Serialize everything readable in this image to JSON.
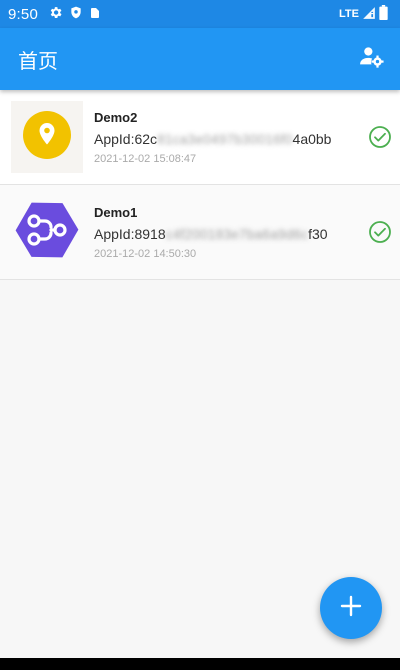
{
  "status_bar": {
    "time": "9:50",
    "network": "LTE",
    "icons": [
      "gear-icon",
      "shield-icon",
      "sim-card-icon",
      "signal-icon",
      "battery-icon"
    ]
  },
  "app_bar": {
    "title": "首页",
    "settings_icon": "user-settings-icon"
  },
  "apps": [
    {
      "name": "Demo2",
      "appid_prefix": "AppId:62c",
      "appid_hidden": "81ca3e0497b30016f0",
      "appid_suffix": "4a0bb",
      "time": "2021-12-02 15:08:47",
      "icon": "location-pin-icon",
      "status_icon": "check-circle-icon"
    },
    {
      "name": "Demo1",
      "appid_prefix": "AppId:8918",
      "appid_hidden": "c4f200183e7ba6a9d6c",
      "appid_suffix": "f30",
      "time": "2021-12-02 14:50:30",
      "icon": "share-graph-icon",
      "status_icon": "check-circle-icon"
    }
  ],
  "fab": {
    "icon": "plus-icon"
  },
  "colors": {
    "primary": "#2196f3",
    "status_bar": "#1e88e5",
    "check": "#4caf50",
    "demo2_icon": "#f2c200",
    "demo1_icon": "#6a4cde"
  }
}
